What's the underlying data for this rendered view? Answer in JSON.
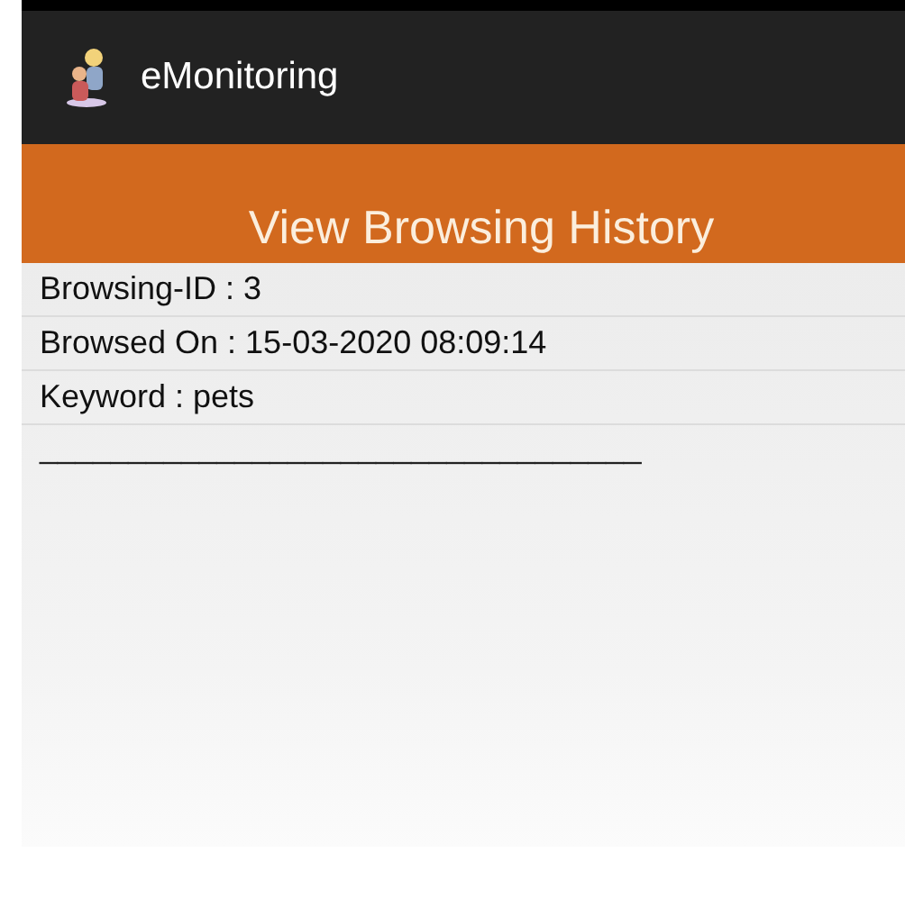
{
  "app_bar": {
    "title": "eMonitoring"
  },
  "header": {
    "title": "View Browsing History"
  },
  "fields": [
    {
      "text": "Browsing-ID : 3"
    },
    {
      "text": "Browsed On : 15-03-2020 08:09:14"
    },
    {
      "text": "Keyword : pets"
    }
  ],
  "separator_text": "__________________________________"
}
